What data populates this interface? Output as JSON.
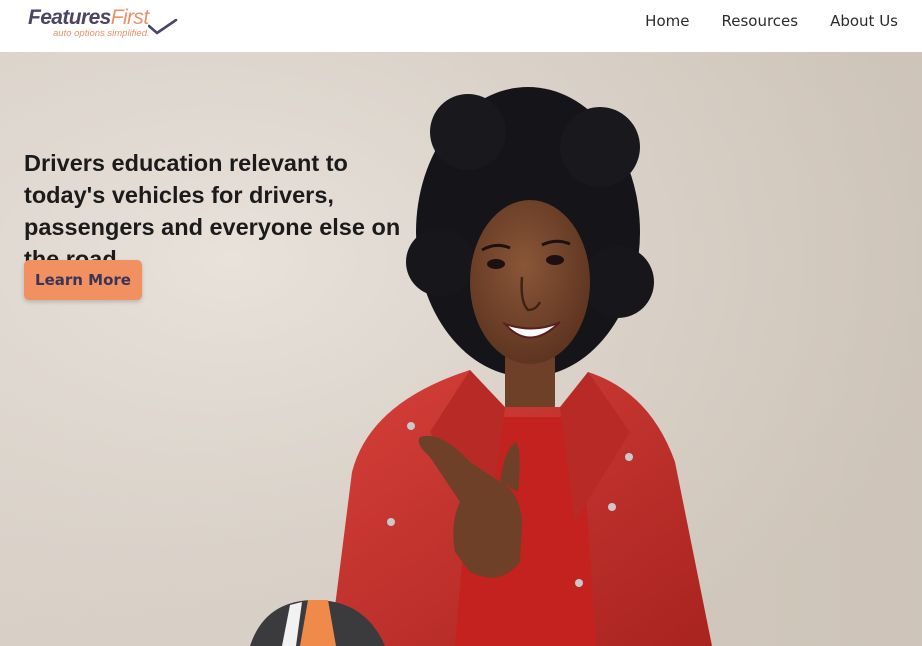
{
  "brand": {
    "name_part1": "Features",
    "name_part2": "First",
    "tagline": "auto options simplified.",
    "colors": {
      "primary": "#4a4566",
      "accent": "#e8916a"
    },
    "icon": "checkmark-icon"
  },
  "nav": {
    "items": [
      {
        "label": "Home"
      },
      {
        "label": "Resources"
      },
      {
        "label": "About Us"
      }
    ]
  },
  "hero": {
    "headline": "Drivers education relevant to today's vehicles for drivers, passengers and everyone else on the road",
    "cta_label": "Learn More",
    "cta_color": "#f19060",
    "image": "woman-in-red-leather-jacket-pointing-photo"
  }
}
